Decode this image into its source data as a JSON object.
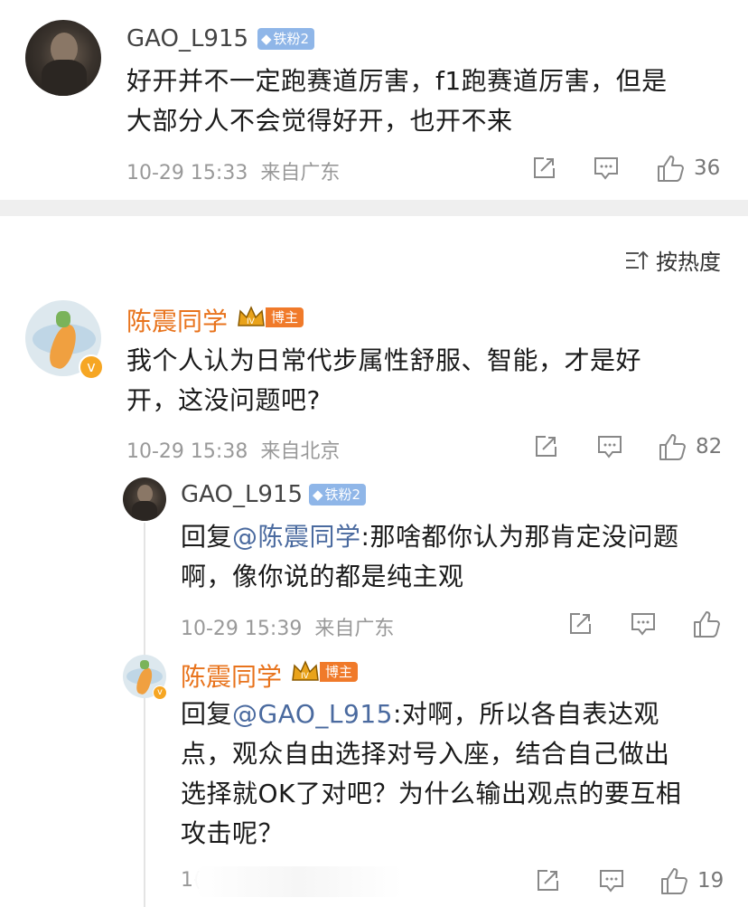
{
  "top_comment": {
    "username": "GAO_L915",
    "fan_badge": "铁粉2",
    "text_line1": "好开并不一定跑赛道厉害，f1跑赛道厉害，但是",
    "text_line2": "大部分人不会觉得好开，也开不来",
    "time": "10-29 15:33",
    "location": "来自广东",
    "likes": "36"
  },
  "sort": {
    "label": "按热度"
  },
  "main_comment": {
    "username": "陈震同学",
    "host_badge": "博主",
    "text_line1": "我个人认为日常代步属性舒服、智能，才是好",
    "text_line2": "开，这没问题吧?",
    "time": "10-29 15:38",
    "location": "来自北京",
    "likes": "82"
  },
  "reply1": {
    "username": "GAO_L915",
    "fan_badge": "铁粉2",
    "prefix": "回复",
    "mention": "@陈震同学",
    "text_after": ":那啥都你认为那肯定没问题",
    "text_line2": "啊，像你说的都是纯主观",
    "time": "10-29 15:39",
    "location": "来自广东"
  },
  "reply2": {
    "username": "陈震同学",
    "host_badge": "博主",
    "prefix": "回复",
    "mention": "@GAO_L915",
    "text_after": ":对啊，所以各自表达观",
    "text_line2": "点，观众自由选择对号入座，结合自己做出",
    "text_line3": "选择就OK了对吧？为什么输出观点的要互相",
    "text_line4": "攻击呢？",
    "time_partial": "1(",
    "likes": "19"
  },
  "colors": {
    "orange_name": "#e8731c",
    "mention_blue": "#4a6a9f",
    "fan_badge": "#8fb6e8",
    "host_badge": "#f07a2a"
  }
}
